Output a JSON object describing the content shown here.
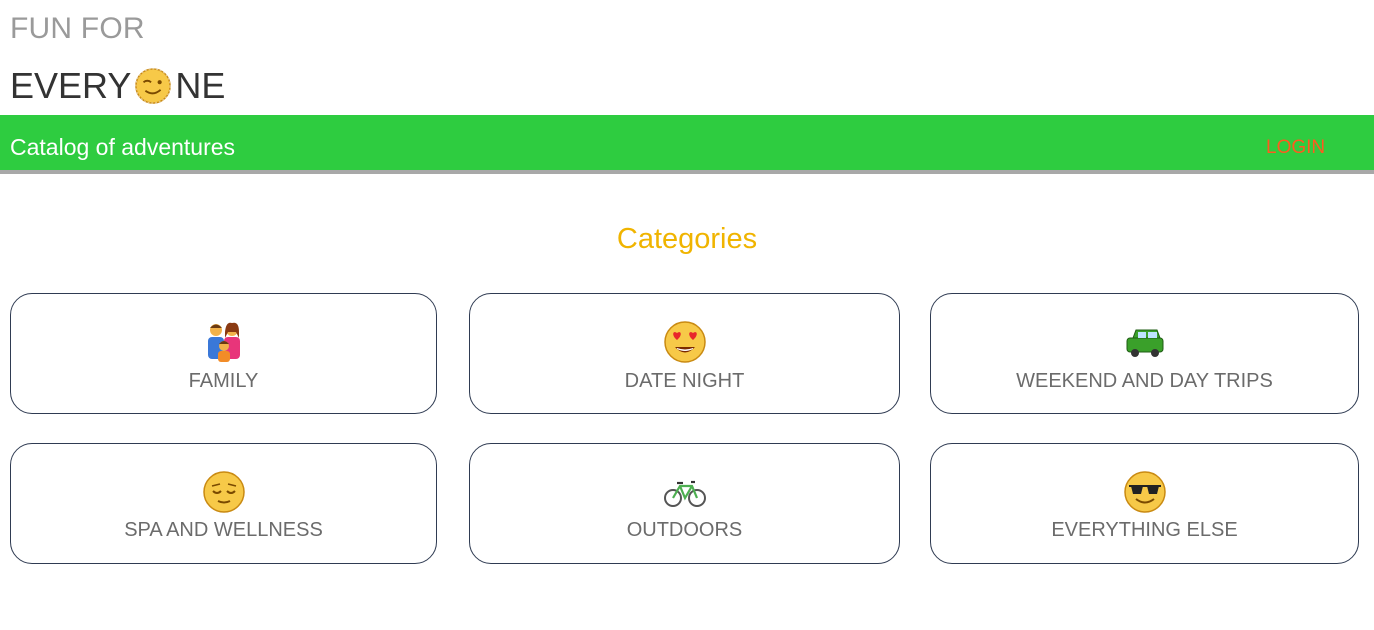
{
  "brand": {
    "line1": "FUN FOR",
    "line2_before": "EVERY",
    "line2_after": "NE",
    "logo_icon": "winking-face-icon"
  },
  "navbar": {
    "title": "Catalog of adventures",
    "login_label": "LOGIN",
    "background_color": "#2ecc40",
    "login_color": "#ff5a1f"
  },
  "main": {
    "heading": "Categories",
    "heading_color": "#f0b400",
    "categories": [
      {
        "label": "FAMILY",
        "icon": "family-icon"
      },
      {
        "label": "DATE NIGHT",
        "icon": "heart-eyes-face-icon"
      },
      {
        "label": "WEEKEND AND DAY TRIPS",
        "icon": "car-icon"
      },
      {
        "label": "SPA AND WELLNESS",
        "icon": "relieved-face-icon"
      },
      {
        "label": "OUTDOORS",
        "icon": "bicycle-icon"
      },
      {
        "label": "EVERYTHING ELSE",
        "icon": "sunglasses-face-icon"
      }
    ]
  }
}
